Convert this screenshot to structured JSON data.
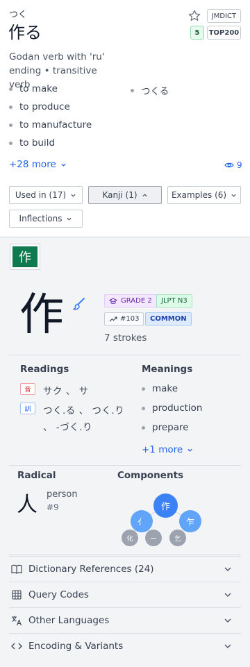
{
  "entry": {
    "reading": "つく",
    "headword": "作る",
    "badges": {
      "source": "JMDICT",
      "rank": "5",
      "top": "TOP200"
    },
    "pos_line1": "Godan verb with 'ru'",
    "pos_line2": "ending • transitive verb",
    "glosses": [
      "to make",
      "to produce",
      "to manufacture",
      "to build"
    ],
    "alt_reading": "つくる",
    "more_label": "+28 more",
    "views": "9",
    "tabs": {
      "used_in": "Used in (17)",
      "kanji": "Kanji (1)",
      "examples": "Examples (6)",
      "inflections": "Inflections"
    }
  },
  "kanji": {
    "chip": "作",
    "character": "作",
    "grade": "GRADE 2",
    "jlpt": "JLPT N3",
    "frequency": "#103",
    "common": "COMMON",
    "strokes": "7 strokes",
    "readings_title": "Readings",
    "on_icon": "音",
    "on_readings": "サク 、 サ",
    "kun_icon": "訓",
    "kun_line1": "つく.る 、 つく.り",
    "kun_line2": "、 -づく.り",
    "meanings_title": "Meanings",
    "meanings": [
      "make",
      "production",
      "prepare"
    ],
    "meanings_more": "+1 more",
    "radical_title": "Radical",
    "radical_char": "人",
    "radical_meaning": "person",
    "radical_number": "#9",
    "components_title": "Components",
    "components": {
      "root": "作",
      "left": "亻",
      "right": "乍",
      "c1": "化",
      "c2": "一",
      "c3": "乞"
    }
  },
  "accordions": [
    "Dictionary References (24)",
    "Query Codes",
    "Other Languages",
    "Encoding & Variants"
  ],
  "colors": {
    "accent": "#2563eb",
    "kanji_green": "#0f7a4f",
    "component_blue": "#3b82f6",
    "component_gray": "#9ca3af"
  },
  "icons": [
    "star-icon",
    "eye-icon",
    "brush-icon",
    "graduation-cap-icon",
    "trend-icon",
    "book-icon",
    "grid-icon",
    "translate-icon",
    "code-icon",
    "chevron-down-icon"
  ]
}
